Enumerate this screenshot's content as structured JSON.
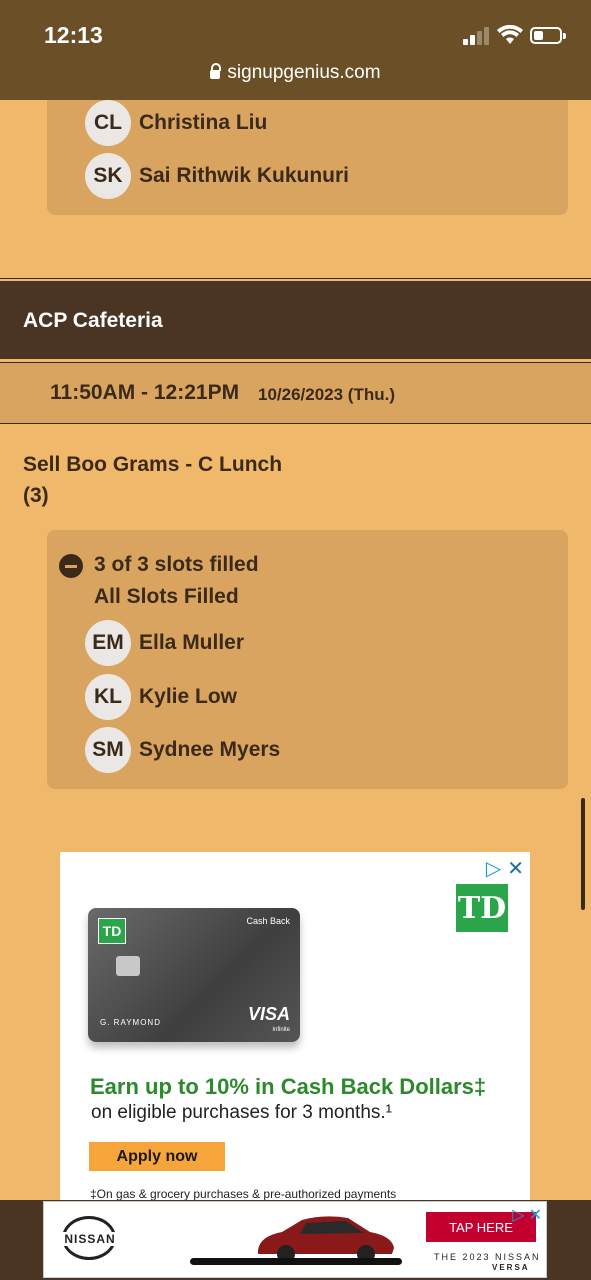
{
  "status_bar": {
    "time": "12:13",
    "url": "signupgenius.com"
  },
  "previous_slot": {
    "people": [
      {
        "initials": "CL",
        "name": "Christina Liu"
      },
      {
        "initials": "SK",
        "name": "Sai Rithwik Kukunuri"
      }
    ]
  },
  "location": {
    "name": "ACP Cafeteria"
  },
  "time_range": {
    "time": "11:50AM - 12:21PM",
    "date": "10/26/2023 (Thu.)"
  },
  "slot": {
    "title_line1": "Sell Boo Grams - C Lunch",
    "title_line2": "(3)",
    "status": "3 of 3 slots filled",
    "status_detail": "All Slots Filled",
    "people": [
      {
        "initials": "EM",
        "name": "Ella Muller"
      },
      {
        "initials": "KL",
        "name": "Kylie Low"
      },
      {
        "initials": "SM",
        "name": "Sydnee Myers"
      }
    ]
  },
  "ad": {
    "logo": "TD",
    "card_label": "Cash Back",
    "card_holder": "G. RAYMOND",
    "card_brand": "VISA",
    "card_tier": "Infinite",
    "headline": "Earn up to 10% in Cash Back Dollars‡",
    "subline": "on eligible purchases for 3 months.¹",
    "button": "Apply now",
    "footnote": "‡On gas & grocery purchases & pre-authorized payments"
  },
  "banner_ad": {
    "brand": "NISSAN",
    "cta": "TAP HERE",
    "model_line1": "THE 2023 NISSAN",
    "model_line2": "VERSA"
  },
  "colors": {
    "page_bg": "#f0b86a",
    "slot_bg": "#d9a460",
    "header_bg": "#4a3423",
    "accent_green": "#2aa54a"
  }
}
